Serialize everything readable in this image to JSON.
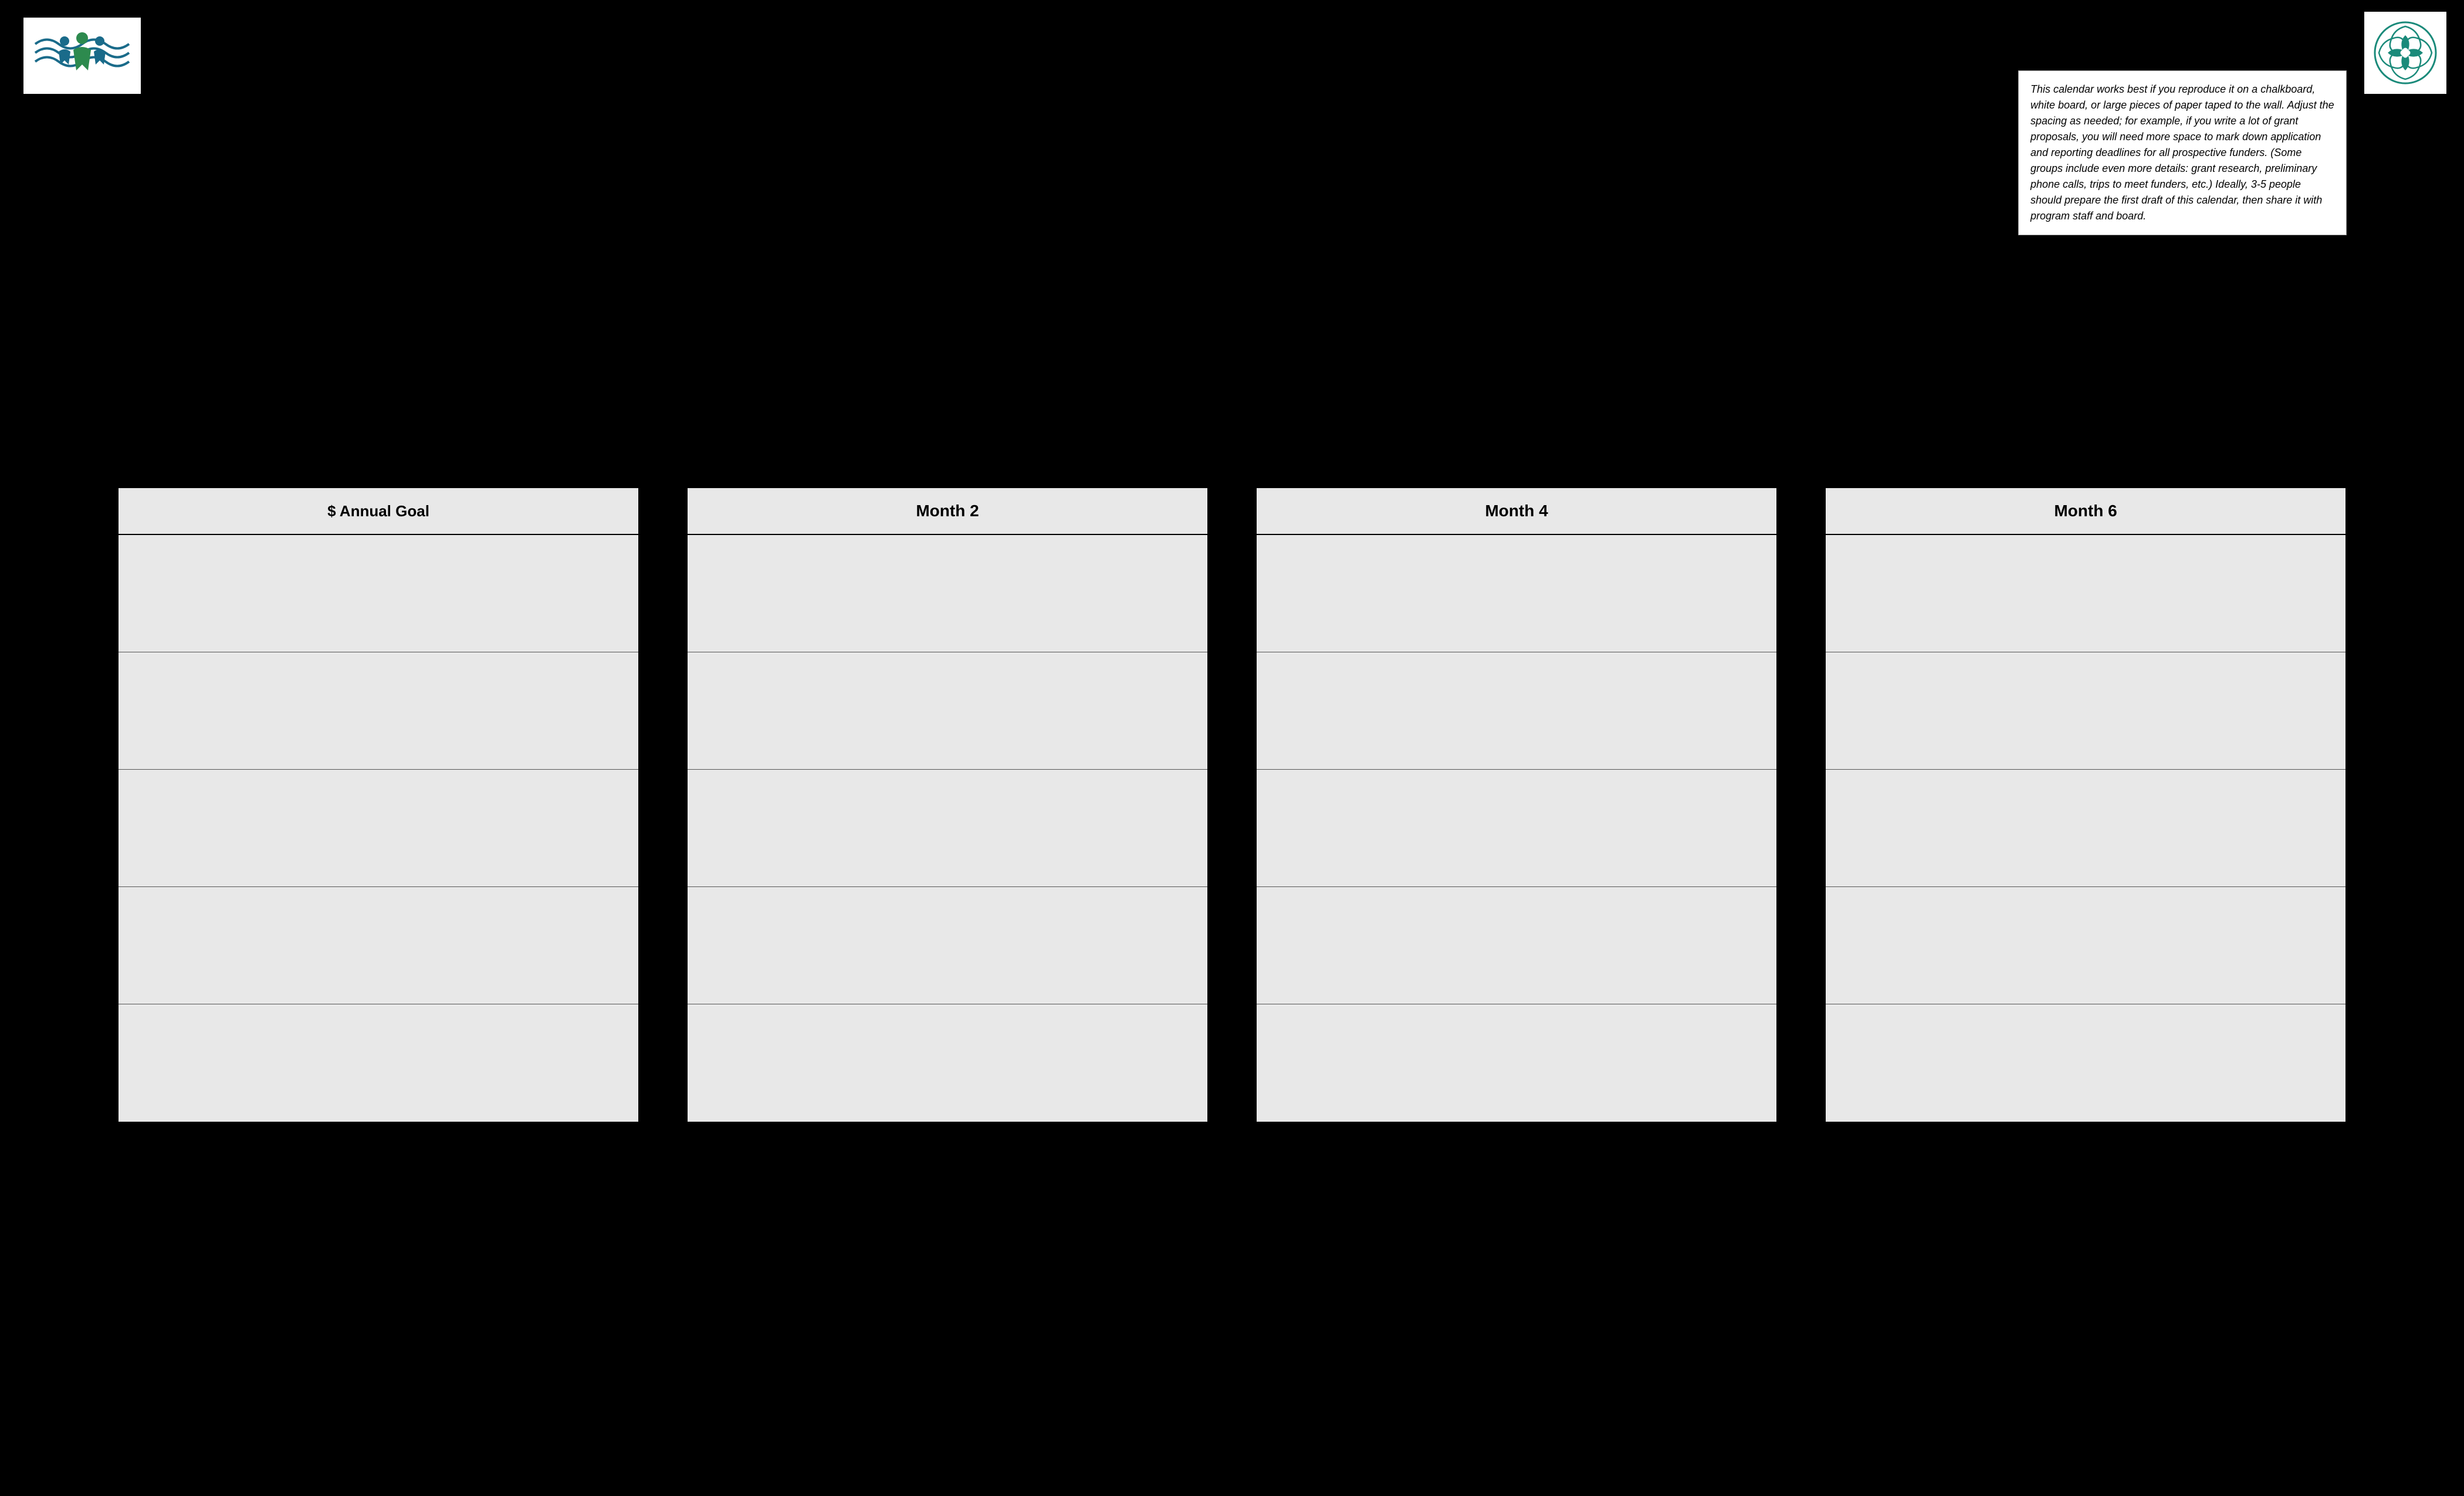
{
  "logos": {
    "left_alt": "Organization waves logo",
    "right_alt": "Teal circular logo"
  },
  "info_box": {
    "text": "This calendar works best if you reproduce it on a chalkboard, white board, or large pieces of paper taped to the wall.  Adjust the spacing as needed; for example, if you write a lot of grant proposals, you will need more space to mark down application and reporting deadlines for all prospective funders. (Some groups include even more details: grant research, preliminary phone calls, trips to meet funders, etc.)  Ideally, 3-5 people should prepare the first draft of this calendar, then share it with program staff and board."
  },
  "columns": [
    {
      "id": "annual",
      "header": "$ Annual Goal",
      "rows": 5
    },
    {
      "id": "month2",
      "header": "Month 2",
      "rows": 5
    },
    {
      "id": "month4",
      "header": "Month 4",
      "rows": 5
    },
    {
      "id": "month6",
      "header": "Month 6",
      "rows": 5
    }
  ]
}
